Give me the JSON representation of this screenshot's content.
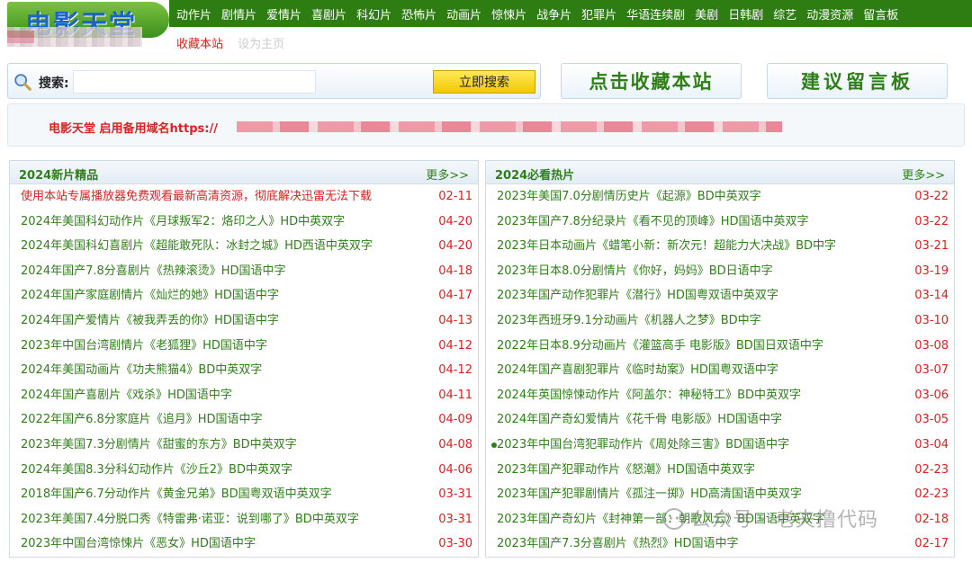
{
  "logo": {
    "text": "电影天堂"
  },
  "nav": [
    "动作片",
    "剧情片",
    "爱情片",
    "喜剧片",
    "科幻片",
    "恐怖片",
    "动画片",
    "惊悚片",
    "战争片",
    "犯罪片",
    "华语连续剧",
    "美剧",
    "日韩剧",
    "综艺",
    "动漫资源",
    "留言板"
  ],
  "sublinks": {
    "favorite": "收藏本站",
    "homepage": "设为主页"
  },
  "search": {
    "label": "搜索:",
    "placeholder": "",
    "value": "",
    "button": "立即搜索"
  },
  "buttons": {
    "collect": "点击收藏本站",
    "guestbook": "建议留言板"
  },
  "notice": {
    "text": "电影天堂 启用备用域名https://"
  },
  "left_panel": {
    "title": "2024新片精品",
    "more": "更多>>",
    "items": [
      {
        "title": "使用本站专属播放器免费观看最新高清资源，彻底解决迅雷无法下载",
        "date": "02-11",
        "hot": true
      },
      {
        "title": "2024年美国科幻动作片《月球叛军2：烙印之人》HD中英双字",
        "date": "04-20"
      },
      {
        "title": "2024年美国科幻喜剧片《超能敢死队：冰封之城》HD西语中英双字",
        "date": "04-20"
      },
      {
        "title": "2024年国产7.8分喜剧片《热辣滚烫》HD国语中字",
        "date": "04-18"
      },
      {
        "title": "2024年国产家庭剧情片《灿烂的她》HD国语中字",
        "date": "04-17"
      },
      {
        "title": "2024年国产爱情片《被我弄丢的你》HD国语中字",
        "date": "04-13"
      },
      {
        "title": "2023年中国台湾剧情片《老狐狸》HD国语中字",
        "date": "04-12"
      },
      {
        "title": "2024年美国动画片《功夫熊猫4》BD中英双字",
        "date": "04-12"
      },
      {
        "title": "2024年国产喜剧片《戏杀》HD国语中字",
        "date": "04-11"
      },
      {
        "title": "2022年国产6.8分家庭片《追月》HD国语中字",
        "date": "04-09"
      },
      {
        "title": "2023年美国7.3分剧情片《甜蜜的东方》BD中英双字",
        "date": "04-08"
      },
      {
        "title": "2024年美国8.3分科幻动作片《沙丘2》BD中英双字",
        "date": "04-06"
      },
      {
        "title": "2018年国产6.7分动作片《黄金兄弟》BD国粤双语中英双字",
        "date": "03-31"
      },
      {
        "title": "2023年美国7.4分脱口秀《特雷弗·诺亚：说到哪了》BD中英双字",
        "date": "03-31"
      },
      {
        "title": "2023年中国台湾惊悚片《恶女》HD国语中字",
        "date": "03-30"
      }
    ]
  },
  "right_panel": {
    "title": "2024必看热片",
    "more": "更多>>",
    "items": [
      {
        "title": "2023年美国7.0分剧情历史片《起源》BD中英双字",
        "date": "03-22"
      },
      {
        "title": "2023年国产7.8分纪录片《看不见的顶峰》HD国语中英双字",
        "date": "03-22"
      },
      {
        "title": "2023年日本动画片《蜡笔小新：新次元！超能力大决战》BD中字",
        "date": "03-21"
      },
      {
        "title": "2023年日本8.0分剧情片《你好，妈妈》BD日语中字",
        "date": "03-19"
      },
      {
        "title": "2023年国产动作犯罪片《潜行》HD国粤双语中英双字",
        "date": "03-14"
      },
      {
        "title": "2023年西班牙9.1分动画片《机器人之梦》BD中字",
        "date": "03-10"
      },
      {
        "title": "2022年日本8.9分动画片《灌篮高手 电影版》BD国日双语中字",
        "date": "03-08"
      },
      {
        "title": "2024年国产喜剧犯罪片《临时劫案》HD国粤双语中字",
        "date": "03-07"
      },
      {
        "title": "2024年英国惊悚动作片《阿盖尔：神秘特工》BD中英双字",
        "date": "03-06"
      },
      {
        "title": "2024年国产奇幻爱情片《花千骨 电影版》HD国语中字",
        "date": "03-05"
      },
      {
        "title": "2023年中国台湾犯罪动作片《周处除三害》BD国语中字",
        "date": "03-04",
        "bullet": true
      },
      {
        "title": "2023年国产犯罪动作片《怒潮》HD国语中英双字",
        "date": "02-23"
      },
      {
        "title": "2023年国产犯罪剧情片《孤注一掷》HD高清国语中英双字",
        "date": "02-23"
      },
      {
        "title": "2023年国产奇幻片《封神第一部：朝歌风云》BD国语中英双字",
        "date": "02-18"
      },
      {
        "title": "2023年国产7.3分喜剧片《热烈》HD国语中字",
        "date": "02-17"
      }
    ]
  },
  "watermark": {
    "text": "公众号 · 老夫撸代码"
  }
}
